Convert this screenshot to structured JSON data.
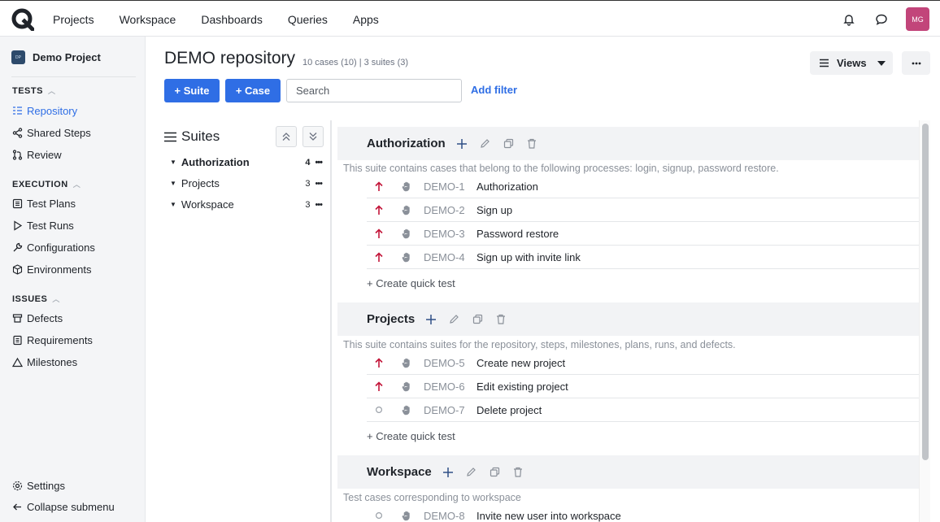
{
  "nav": {
    "items": [
      "Projects",
      "Workspace",
      "Dashboards",
      "Queries",
      "Apps"
    ],
    "avatar": "MG"
  },
  "sidebar": {
    "project_badge": "DP",
    "project_name": "Demo Project",
    "tests_header": "TESTS",
    "tests": [
      "Repository",
      "Shared Steps",
      "Review"
    ],
    "execution_header": "EXECUTION",
    "execution": [
      "Test Plans",
      "Test Runs",
      "Configurations",
      "Environments"
    ],
    "issues_header": "ISSUES",
    "issues": [
      "Defects",
      "Requirements",
      "Milestones"
    ],
    "settings": "Settings",
    "collapse": "Collapse submenu"
  },
  "header": {
    "title": "DEMO repository",
    "subtitle": "10 cases (10) | 3 suites (3)",
    "views_label": "Views",
    "suite_button": "+ Suite",
    "case_button": "+ Case",
    "search_placeholder": "Search",
    "add_filter": "Add filter"
  },
  "tree": {
    "title": "Suites",
    "items": [
      {
        "name": "Authorization",
        "count": "4"
      },
      {
        "name": "Projects",
        "count": "3"
      },
      {
        "name": "Workspace",
        "count": "3"
      }
    ]
  },
  "suites": [
    {
      "title": "Authorization",
      "description": "This suite contains cases that belong to the following processes: login, signup, password restore.",
      "cases": [
        {
          "id": "DEMO-1",
          "name": "Authorization",
          "priority": "high"
        },
        {
          "id": "DEMO-2",
          "name": "Sign up",
          "priority": "high"
        },
        {
          "id": "DEMO-3",
          "name": "Password restore",
          "priority": "high"
        },
        {
          "id": "DEMO-4",
          "name": "Sign up with invite link",
          "priority": "high"
        }
      ],
      "quick": "+ Create quick test"
    },
    {
      "title": "Projects",
      "description": "This suite contains suites for the repository, steps, milestones, plans, runs, and defects.",
      "cases": [
        {
          "id": "DEMO-5",
          "name": "Create new project",
          "priority": "high"
        },
        {
          "id": "DEMO-6",
          "name": "Edit existing project",
          "priority": "high"
        },
        {
          "id": "DEMO-7",
          "name": "Delete project",
          "priority": "none"
        }
      ],
      "quick": "+ Create quick test"
    },
    {
      "title": "Workspace",
      "description": "Test cases corresponding to workspace",
      "cases": [
        {
          "id": "DEMO-8",
          "name": "Invite new user into workspace",
          "priority": "none"
        }
      ]
    }
  ],
  "colors": {
    "accent": "#2f6ee5",
    "priority_high": "#c3163a",
    "avatar": "#c2457a"
  }
}
